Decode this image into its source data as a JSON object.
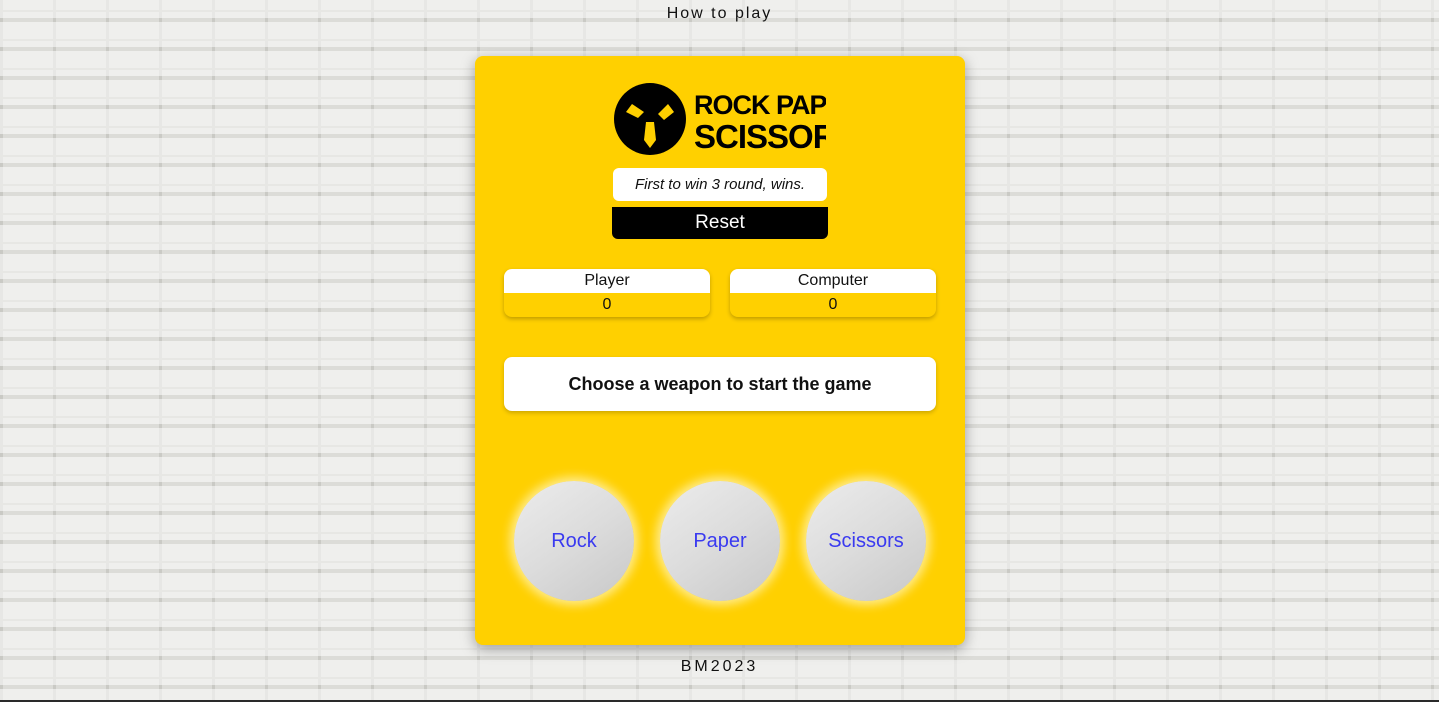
{
  "header": {
    "how_to_play_label": "How to play"
  },
  "logo": {
    "line1": "ROCK PAPER",
    "line2": "SCISSORS"
  },
  "rules": {
    "text": "First to win 3 round, wins."
  },
  "reset": {
    "label": "Reset"
  },
  "scores": {
    "player": {
      "label": "Player",
      "value": "0"
    },
    "computer": {
      "label": "Computer",
      "value": "0"
    }
  },
  "message": {
    "text": "Choose a weapon to start the game"
  },
  "weapons": [
    {
      "label": "Rock"
    },
    {
      "label": "Paper"
    },
    {
      "label": "Scissors"
    }
  ],
  "footer": {
    "text": "BM2023"
  },
  "colors": {
    "card_background": "#ffd000",
    "weapon_text": "#3a3af0",
    "reset_background": "#000000"
  }
}
